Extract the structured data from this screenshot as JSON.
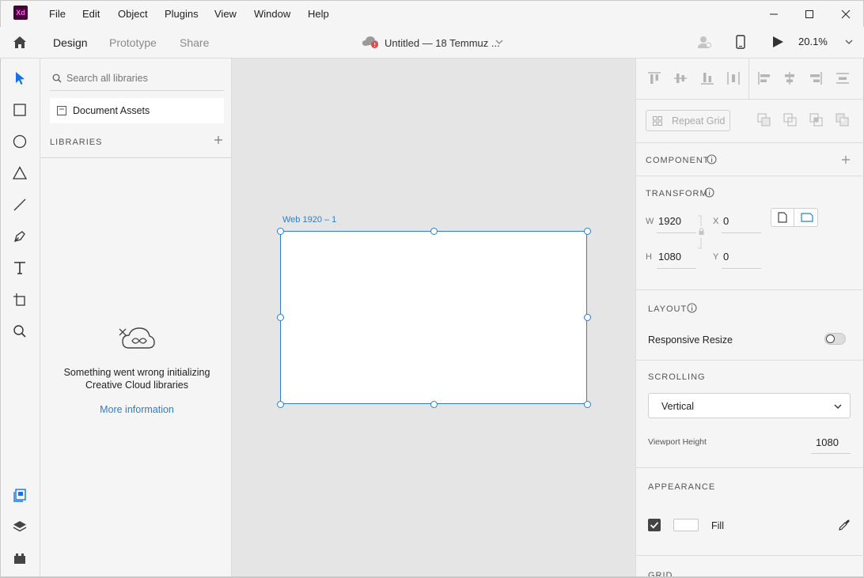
{
  "app": {
    "logo_text": "Xd"
  },
  "menu": [
    "File",
    "Edit",
    "Object",
    "Plugins",
    "View",
    "Window",
    "Help"
  ],
  "modes": {
    "design": "Design",
    "prototype": "Prototype",
    "share": "Share"
  },
  "document": {
    "title": "Untitled — 18 Temmuz ..."
  },
  "zoom": "20.1%",
  "libraries": {
    "search_placeholder": "Search all libraries",
    "document_assets": "Document Assets",
    "section_label": "LIBRARIES",
    "error_message": "Something went wrong initializing Creative Cloud libraries",
    "more_info": "More information"
  },
  "artboard": {
    "name": "Web 1920 – 1"
  },
  "inspector": {
    "repeat_grid": "Repeat Grid",
    "component_title": "COMPONENT",
    "transform_title": "TRANSFORM",
    "w_label": "W",
    "w_value": "1920",
    "h_label": "H",
    "h_value": "1080",
    "x_label": "X",
    "x_value": "0",
    "y_label": "Y",
    "y_value": "0",
    "layout_title": "LAYOUT",
    "responsive_resize": "Responsive Resize",
    "responsive_resize_on": false,
    "scrolling_title": "SCROLLING",
    "scrolling_value": "Vertical",
    "viewport_height_label": "Viewport Height",
    "viewport_height_value": "1080",
    "appearance_title": "APPEARANCE",
    "fill_label": "Fill",
    "fill_enabled": true,
    "fill_color": "#ffffff",
    "grid_title": "GRID"
  },
  "colors": {
    "accent": "#2d7ec8",
    "brand": "#470137",
    "error": "#e34850"
  }
}
